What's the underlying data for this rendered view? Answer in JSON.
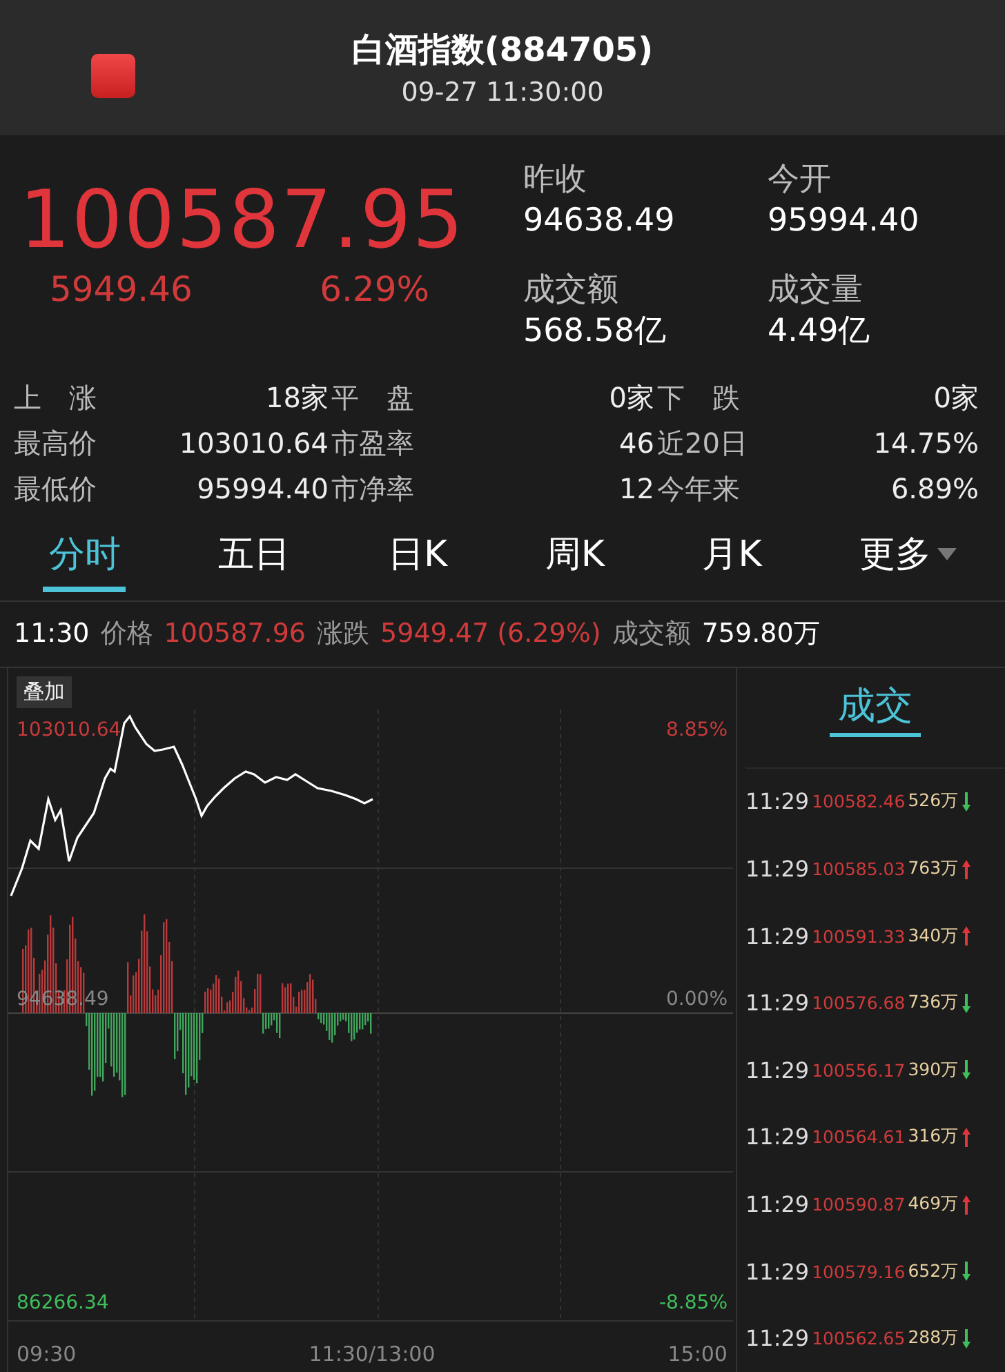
{
  "header": {
    "title": "白酒指数(884705)",
    "subtitle": "09-27 11:30:00"
  },
  "quote": {
    "price": "100587.95",
    "change": "5949.46",
    "change_pct": "6.29%"
  },
  "summary": [
    {
      "label": "昨收",
      "value": "94638.49"
    },
    {
      "label": "今开",
      "value": "95994.40"
    },
    {
      "label": "成交额",
      "value": "568.58亿"
    },
    {
      "label": "成交量",
      "value": "4.49亿"
    }
  ],
  "stats": [
    [
      {
        "label": "上　涨",
        "value": "18家"
      },
      {
        "label": "平　盘",
        "value": "0家"
      },
      {
        "label": "下　跌",
        "value": "0家"
      }
    ],
    [
      {
        "label": "最高价",
        "value": "103010.64"
      },
      {
        "label": "市盈率",
        "value": "46"
      },
      {
        "label": "近20日",
        "value": "14.75%"
      }
    ],
    [
      {
        "label": "最低价",
        "value": "95994.40"
      },
      {
        "label": "市净率",
        "value": "12"
      },
      {
        "label": "今年来",
        "value": "6.89%"
      }
    ]
  ],
  "tabs": [
    {
      "label": "分时",
      "selected": true
    },
    {
      "label": "五日",
      "selected": false
    },
    {
      "label": "日K",
      "selected": false
    },
    {
      "label": "周K",
      "selected": false
    },
    {
      "label": "月K",
      "selected": false
    },
    {
      "label": "更多",
      "selected": false,
      "dropdown": true
    }
  ],
  "crosshair": {
    "time": "11:30",
    "price_label": "价格",
    "price": "100587.96",
    "change_label": "涨跌",
    "change": "5949.47 (6.29%)",
    "amount_label": "成交额",
    "amount": "759.80万"
  },
  "chart": {
    "overlay_button": "叠加",
    "high": "103010.64",
    "high_pct": "8.85%",
    "base": "94638.49",
    "base_pct": "0.00%",
    "low": "86266.34",
    "low_pct": "-8.85%",
    "x_labels": [
      "09:30",
      "11:30/13:00",
      "15:00"
    ]
  },
  "trades_tab": "成交",
  "trades": [
    {
      "time": "11:29",
      "price": "100582.46",
      "volume": "526万",
      "rising": false
    },
    {
      "time": "11:29",
      "price": "100585.03",
      "volume": "763万",
      "rising": true
    },
    {
      "time": "11:29",
      "price": "100591.33",
      "volume": "340万",
      "rising": true
    },
    {
      "time": "11:29",
      "price": "100576.68",
      "volume": "736万",
      "rising": false
    },
    {
      "time": "11:29",
      "price": "100556.17",
      "volume": "390万",
      "rising": false
    },
    {
      "time": "11:29",
      "price": "100564.61",
      "volume": "316万",
      "rising": true
    },
    {
      "time": "11:29",
      "price": "100590.87",
      "volume": "469万",
      "rising": true
    },
    {
      "time": "11:29",
      "price": "100579.16",
      "volume": "652万",
      "rising": false
    },
    {
      "time": "11:29",
      "price": "100562.65",
      "volume": "288万",
      "rising": false
    }
  ]
}
